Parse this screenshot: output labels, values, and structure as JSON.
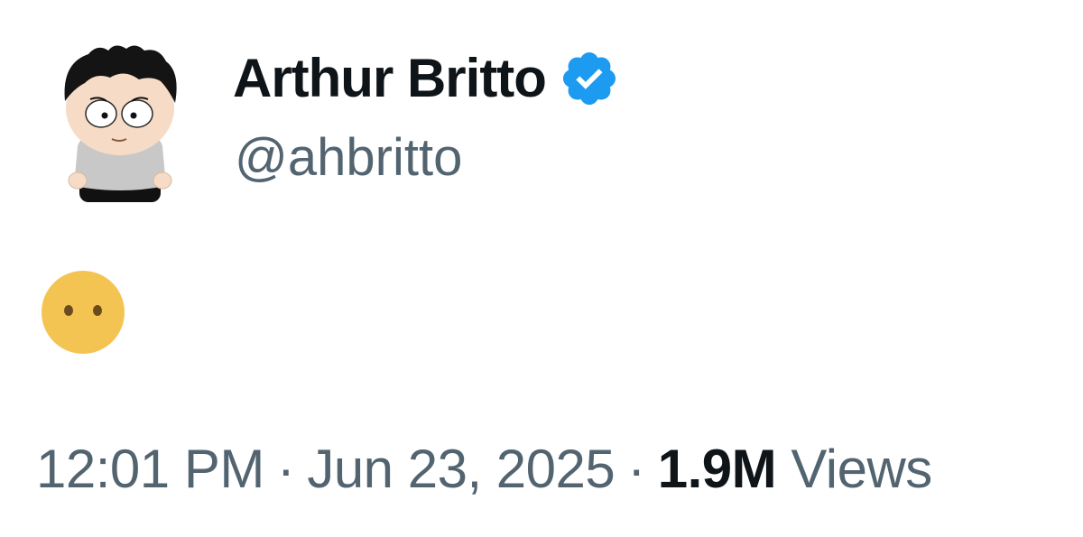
{
  "author": {
    "display_name": "Arthur Britto",
    "handle": "@ahbritto",
    "verified": true,
    "avatar_icon": "cartoon-character-avatar"
  },
  "tweet": {
    "content_emoji": "face-without-mouth",
    "content_emoji_char": "😶"
  },
  "meta": {
    "time": "12:01 PM",
    "separator": "·",
    "date": "Jun 23, 2025",
    "views_count": "1.9M",
    "views_label": "Views"
  },
  "colors": {
    "primary_text": "#0f1419",
    "secondary_text": "#536471",
    "verified_blue": "#1d9bf0",
    "emoji_yellow": "#f4c452"
  }
}
